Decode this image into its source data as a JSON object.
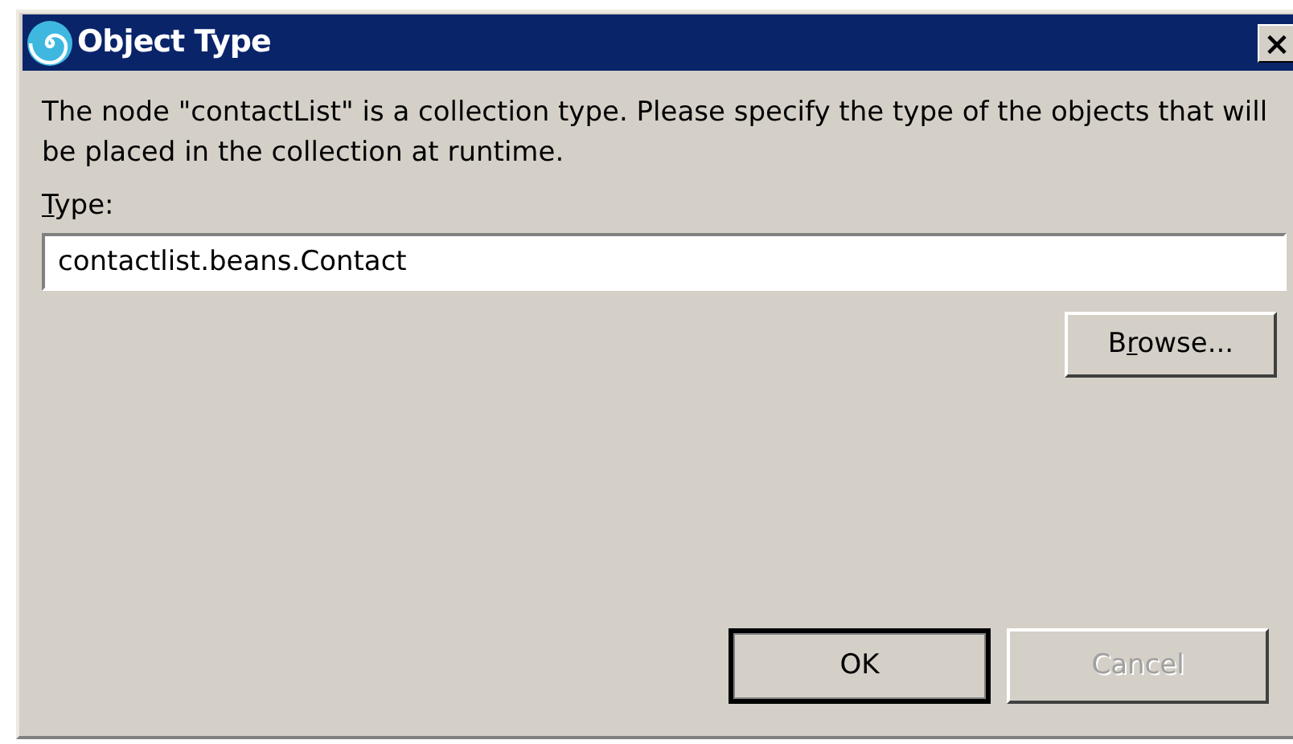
{
  "window": {
    "title": "Object Type",
    "close_label": "×"
  },
  "message": "The node \"contactList\" is a collection type. Please specify the type of the objects that will be placed in the collection at runtime.",
  "type_label": {
    "key": "T",
    "after": "ype:"
  },
  "type_field": {
    "value": "contactlist.beans.Contact"
  },
  "browse_button": {
    "before": "B",
    "key": "r",
    "after": "owse...",
    "disabled": false
  },
  "buttons": [
    {
      "label": "OK",
      "default": true,
      "disabled": false
    },
    {
      "label": "Cancel",
      "default": false,
      "disabled": true
    }
  ]
}
